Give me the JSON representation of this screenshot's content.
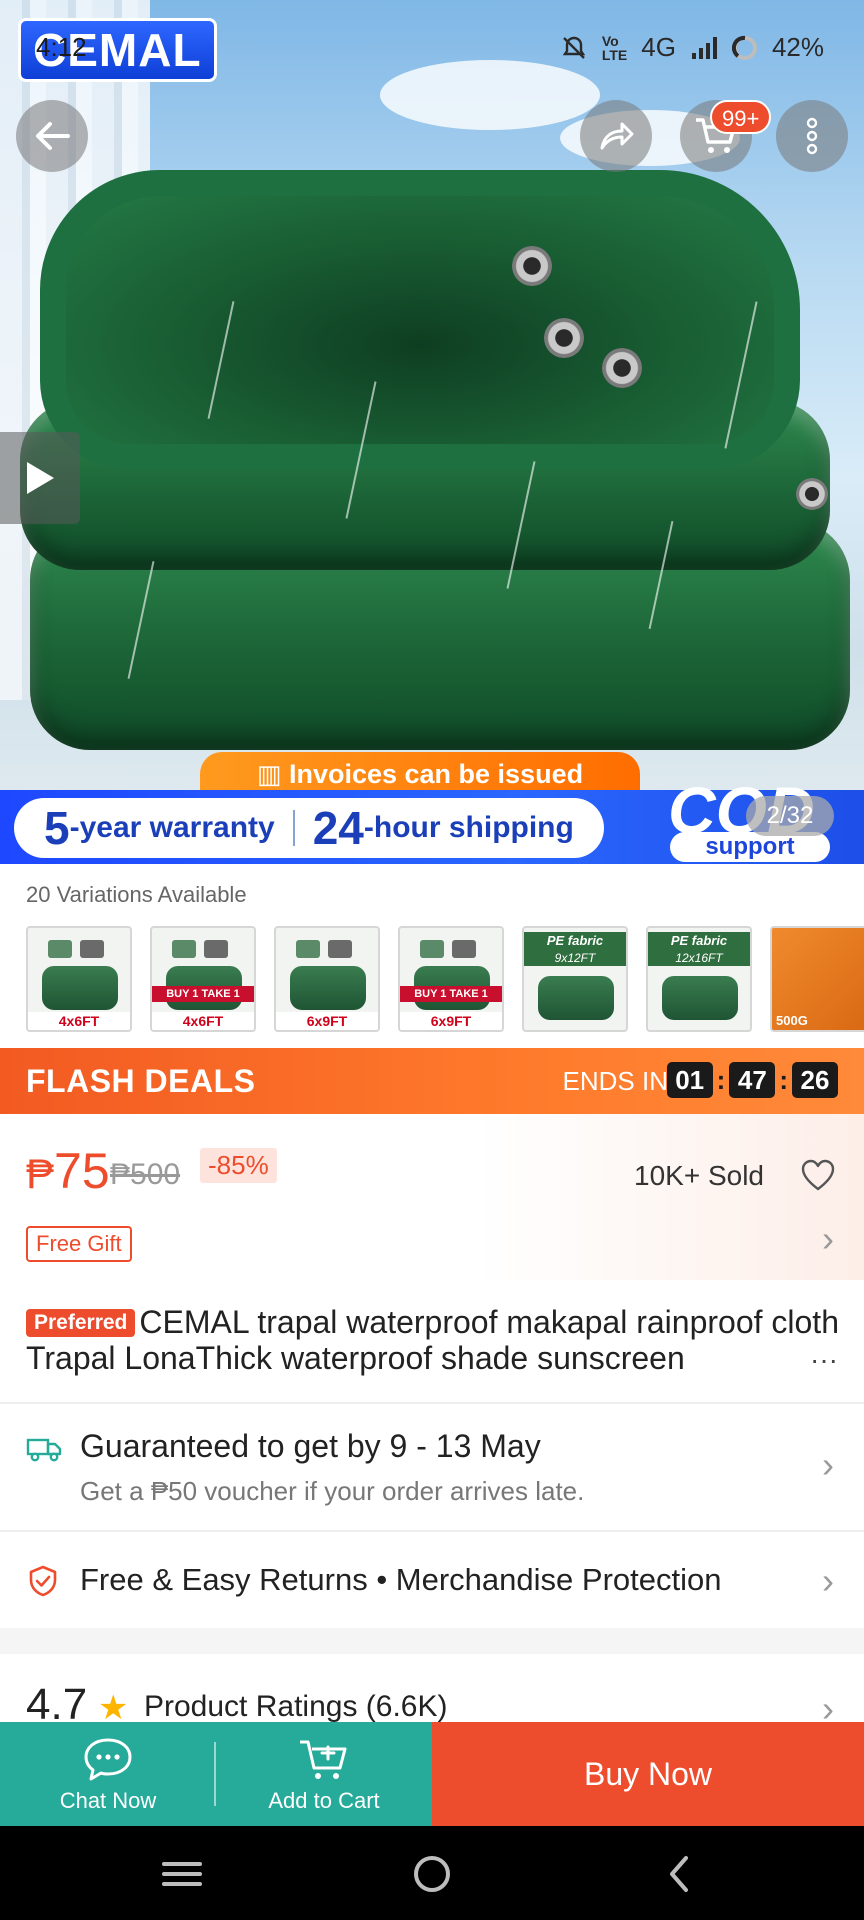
{
  "status_bar": {
    "time": "4:12",
    "battery": "42%",
    "network": "4G"
  },
  "hero": {
    "brand": "CEMAL",
    "cart_badge": "99+",
    "banner_top": "Invoices can be issued",
    "warranty_num": "5",
    "warranty_text": "-year warranty",
    "shipping_num": "24",
    "shipping_text": "-hour shipping",
    "cod": "COD",
    "cod_support": "support",
    "page_indicator": "2/32"
  },
  "variations": {
    "label": "20 Variations Available",
    "items": [
      {
        "tag": "4x6FT",
        "promo": ""
      },
      {
        "tag": "4x6FT",
        "promo": "BUY 1 TAKE 1"
      },
      {
        "tag": "6x9FT",
        "promo": ""
      },
      {
        "tag": "6x9FT",
        "promo": "BUY 1 TAKE 1"
      },
      {
        "fabric": "PE fabric",
        "size": "9x12FT"
      },
      {
        "fabric": "PE fabric",
        "size": "12x16FT"
      },
      {
        "foot": "500G"
      }
    ]
  },
  "flash": {
    "title": "FLASH DEALS",
    "ends_label": "ENDS IN",
    "hours": "01",
    "minutes": "47",
    "seconds": "26"
  },
  "price": {
    "currency": "₱",
    "current": "75",
    "original": "₱500",
    "discount": "-85%",
    "sold": "10K+ Sold",
    "free_gift": "Free Gift"
  },
  "product": {
    "badge": "Preferred",
    "title": "CEMAL trapal waterproof makapal rainproof cloth Trapal LonaThick waterproof shade sunscreen",
    "more": "···"
  },
  "shipping": {
    "title": "Guaranteed to get by 9 - 13 May",
    "subtitle": "Get a ₱50 voucher if your order arrives late."
  },
  "returns": {
    "text": "Free & Easy Returns  •  Merchandise Protection"
  },
  "ratings": {
    "score": "4.7",
    "label": "Product Ratings (6.6K)"
  },
  "actions": {
    "chat": "Chat Now",
    "add_cart": "Add to Cart",
    "buy": "Buy Now"
  },
  "colors": {
    "accent": "#ee4d2d",
    "teal": "#26aa99",
    "flash": "#f25a22"
  }
}
